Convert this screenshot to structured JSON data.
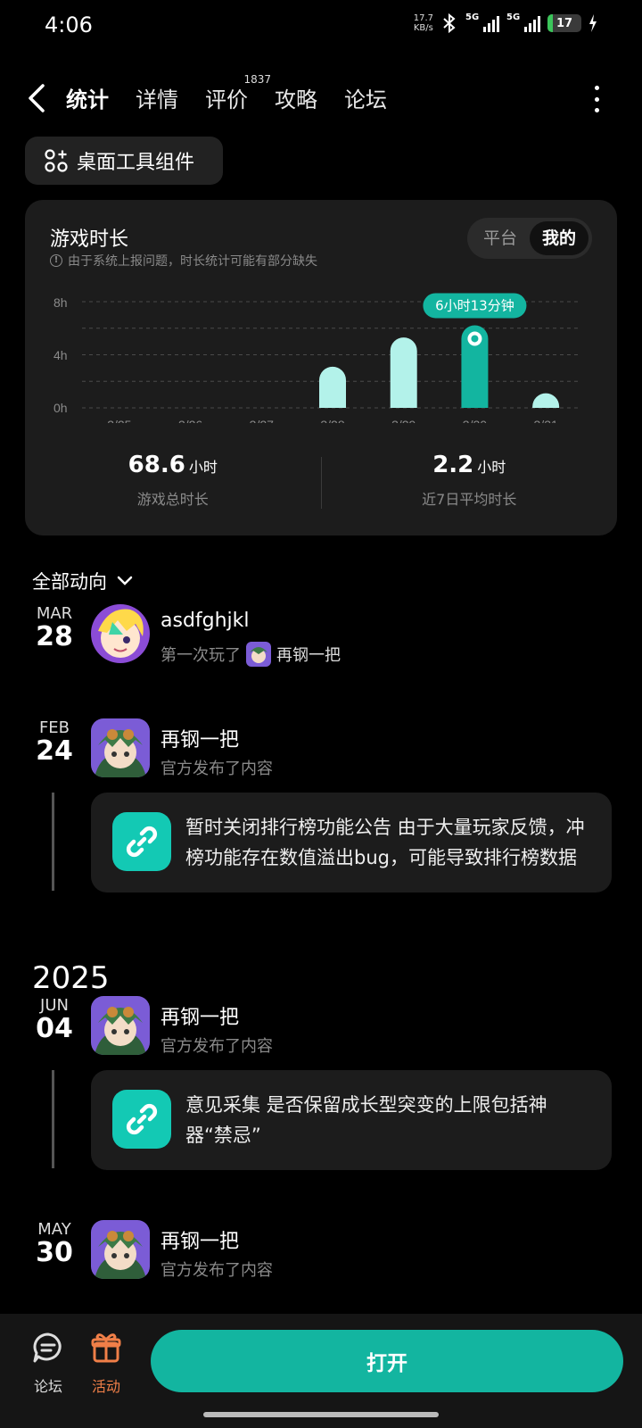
{
  "status": {
    "time": "4:06",
    "net_speed_value": "17.7",
    "net_speed_unit": "KB/s",
    "network_1": "5G",
    "network_2": "5G",
    "battery": "17",
    "battery_level": 17
  },
  "nav": {
    "tabs": [
      {
        "label": "统计",
        "active": true
      },
      {
        "label": "详情"
      },
      {
        "label": "评价",
        "badge": "1837"
      },
      {
        "label": "攻略"
      },
      {
        "label": "论坛"
      }
    ]
  },
  "widget_button": "桌面工具组件",
  "playtime": {
    "title": "游戏时长",
    "note": "由于系统上报问题，时长统计可能有部分缺失",
    "toggle": [
      "平台",
      "我的"
    ],
    "toggle_selected": "我的",
    "tooltip": "6小时13分钟",
    "total_value": "68.6",
    "total_unit": "小时",
    "total_label": "游戏总时长",
    "avg_value": "2.2",
    "avg_unit": "小时",
    "avg_label": "近7日平均时长"
  },
  "chart_data": {
    "type": "bar",
    "categories": [
      "3/25",
      "3/26",
      "3/27",
      "3/28",
      "3/29",
      "3/30",
      "3/31"
    ],
    "values": [
      0,
      0,
      0,
      3.1,
      5.3,
      6.22,
      1.1
    ],
    "ytick_labels": [
      "8h",
      "4h",
      "0h"
    ],
    "ylim": [
      0,
      8
    ],
    "highlighted_index": 5,
    "colors": {
      "bar": "#b3f2ea",
      "highlight": "#13b5a0"
    }
  },
  "filter": "全部动向",
  "feed": [
    {
      "month": "MAR",
      "day": "28",
      "name": "asdfghjkl",
      "action": "第一次玩了",
      "game": "再钢一把"
    },
    {
      "month": "FEB",
      "day": "24",
      "name": "再钢一把",
      "action": "官方发布了内容",
      "post": "暂时关闭排行榜功能公告 由于大量玩家反馈，冲榜功能存在数值溢出bug，可能导致排行榜数据异常"
    },
    {
      "year": "2025"
    },
    {
      "month": "JUN",
      "day": "04",
      "name": "再钢一把",
      "action": "官方发布了内容",
      "post": "意见采集 是否保留成长型突变的上限包括神器“禁忌”"
    },
    {
      "month": "MAY",
      "day": "30",
      "name": "再钢一把",
      "action": "官方发布了内容"
    }
  ],
  "bottom": {
    "forum": "论坛",
    "activity": "活动",
    "open": "打开"
  },
  "colors": {
    "accent": "#13b5a0",
    "activity": "#f07f48"
  }
}
